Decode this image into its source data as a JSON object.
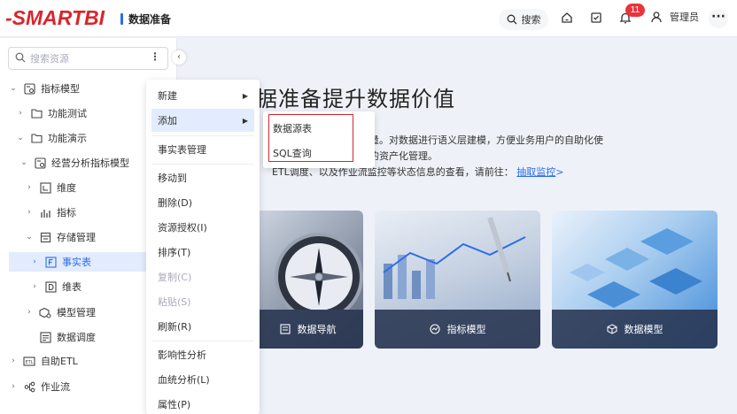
{
  "header": {
    "logo": "SMARTBI",
    "module_title": "数据准备",
    "search_label": "搜索",
    "notification_count": "11",
    "user_label": "管理员",
    "more_label": "···"
  },
  "sidebar": {
    "search_placeholder": "搜索资源",
    "items": [
      {
        "label": "指标模型"
      },
      {
        "label": "功能测试"
      },
      {
        "label": "功能演示"
      },
      {
        "label": "经营分析指标模型"
      },
      {
        "label": "维度"
      },
      {
        "label": "指标"
      },
      {
        "label": "存储管理"
      },
      {
        "label": "事实表"
      },
      {
        "label": "维表"
      },
      {
        "label": "模型管理"
      },
      {
        "label": "数据调度"
      },
      {
        "label": "自助ETL"
      },
      {
        "label": "作业流"
      }
    ]
  },
  "context_menu": {
    "items": [
      {
        "label": "新建"
      },
      {
        "label": "添加"
      },
      {
        "label": "事实表管理"
      },
      {
        "label": "移动到"
      },
      {
        "label": "删除(D)"
      },
      {
        "label": "资源授权(I)"
      },
      {
        "label": "排序(T)"
      },
      {
        "label": "复制(C)"
      },
      {
        "label": "粘贴(S)"
      },
      {
        "label": "刷新(R)"
      },
      {
        "label": "影响性分析"
      },
      {
        "label": "血统分析(L)"
      },
      {
        "label": "属性(P)"
      }
    ],
    "submenu": [
      "数据源表",
      "SQL查询"
    ]
  },
  "main": {
    "title": "据准备提升数据价值",
    "desc_line1": "戉等处理，提高数据质量。对数据进行语义层建模，方便业务用户的自助化使",
    "desc_line2": "的指标体系，进行数据的资产化管理。",
    "desc_line3": "ETL调度、以及作业流监控等状态信息的查看，请前往：",
    "desc_link": "抽取监控",
    "desc_link_arrow": ">",
    "cards": [
      {
        "label": "数据导航"
      },
      {
        "label": "指标模型"
      },
      {
        "label": "数据模型"
      }
    ]
  },
  "colors": {
    "brand_red": "#d8262c",
    "accent_blue": "#2b6dea",
    "selected_bg": "#e3ecfd"
  }
}
